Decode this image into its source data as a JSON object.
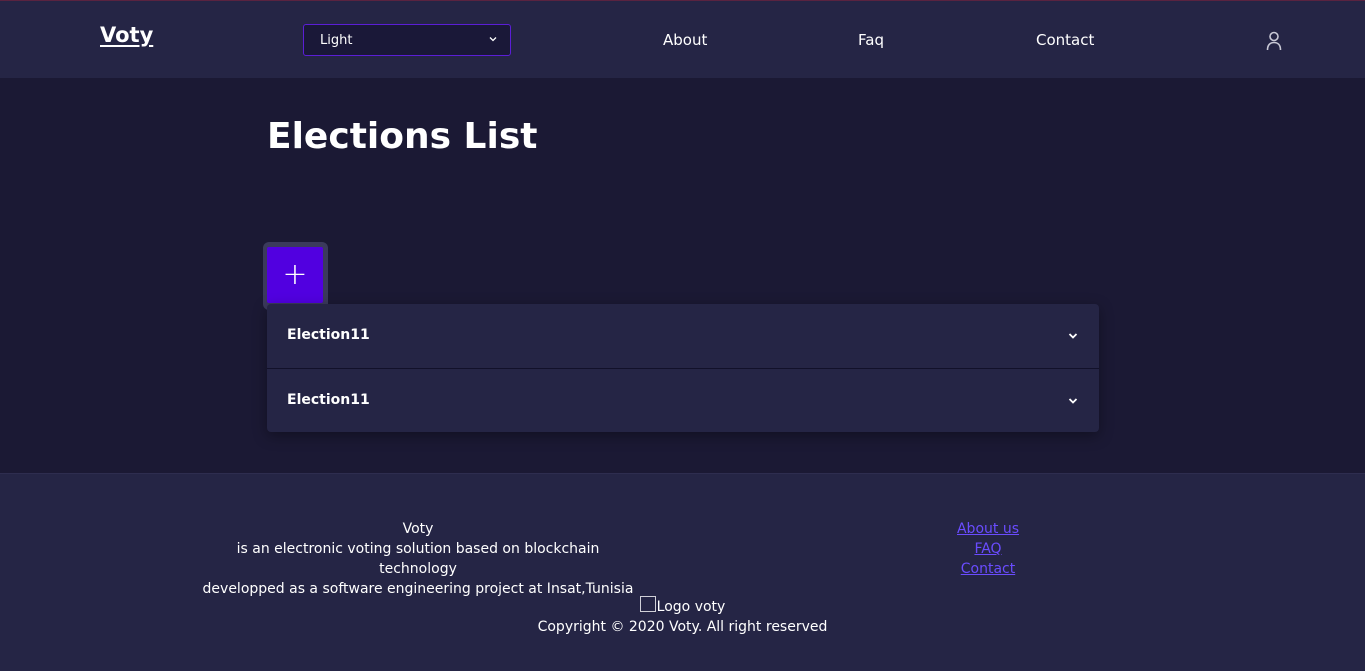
{
  "header": {
    "brand": "Voty",
    "theme_select": {
      "value": "Light"
    },
    "nav": {
      "about": "About",
      "faq": "Faq",
      "contact": "Contact"
    },
    "user_icon": "user-icon"
  },
  "main": {
    "title": "Elections List",
    "add_button": "+",
    "elections": [
      {
        "name": "Election11"
      },
      {
        "name": "Election11"
      }
    ]
  },
  "footer": {
    "about": {
      "name": "Voty",
      "line1": "is an electronic voting solution based on blockchain technology",
      "line2": "developped as a software engineering project at Insat,Tunisia"
    },
    "links": {
      "about_us": "About us",
      "faq": "FAQ",
      "contact": "Contact"
    },
    "logo_alt": "Logo voty",
    "copyright": "Copyright © 2020 Voty. All right reserved"
  },
  "colors": {
    "accent": "#5100e0",
    "header_bg": "#252545",
    "page_bg": "#1b1934",
    "link": "#6a4cff"
  }
}
